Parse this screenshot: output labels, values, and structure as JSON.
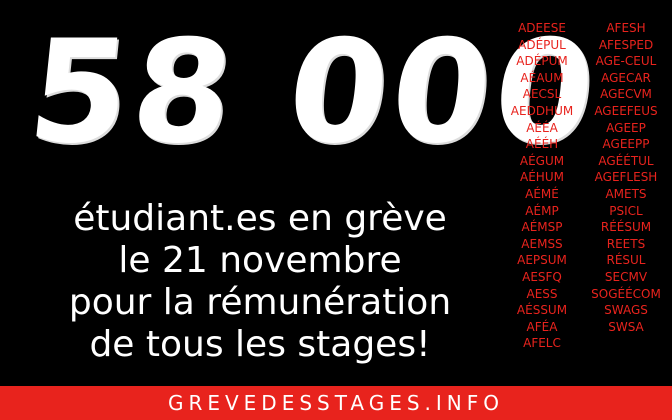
{
  "headline": "58 000",
  "subtitle": {
    "line1": "étudiant.es en grève",
    "line2": "le 21 novembre",
    "line3": "pour la rémunération",
    "line4": "de tous les stages!"
  },
  "organizations": {
    "left": [
      "ADEESE",
      "ADÉPUL",
      "ADÉPUM",
      "AÉAUM",
      "AECSL",
      "AEDDHUM",
      "AÉÉA",
      "AÉÉH",
      "AÉGUM",
      "AÉHUM",
      "AÉMÉ",
      "AÉMP",
      "AÉMSP",
      "AEMSS",
      "AEPSUM",
      "AESFQ",
      "AESS",
      "AÉSSUM",
      "AFÉA",
      "AFELC"
    ],
    "right": [
      "AFESH",
      "AFESPED",
      "AGE-CEUL",
      "AGECAR",
      "AGECVM",
      "AGEEFEUS",
      "AGEEP",
      "AGEEPP",
      "AGÉÉTUL",
      "AGEFLESH",
      "AMETS",
      "PSICL",
      "RÉÉSUM",
      "REETS",
      "RÉSUL",
      "SECMV",
      "SOGÉÉCOM",
      "SWAGS",
      "SWSA"
    ]
  },
  "footer": {
    "link_text": "GREVEDESSTAGES.INFO"
  },
  "colors": {
    "background": "#000000",
    "accent_red": "#e8231d",
    "text": "#ffffff"
  }
}
